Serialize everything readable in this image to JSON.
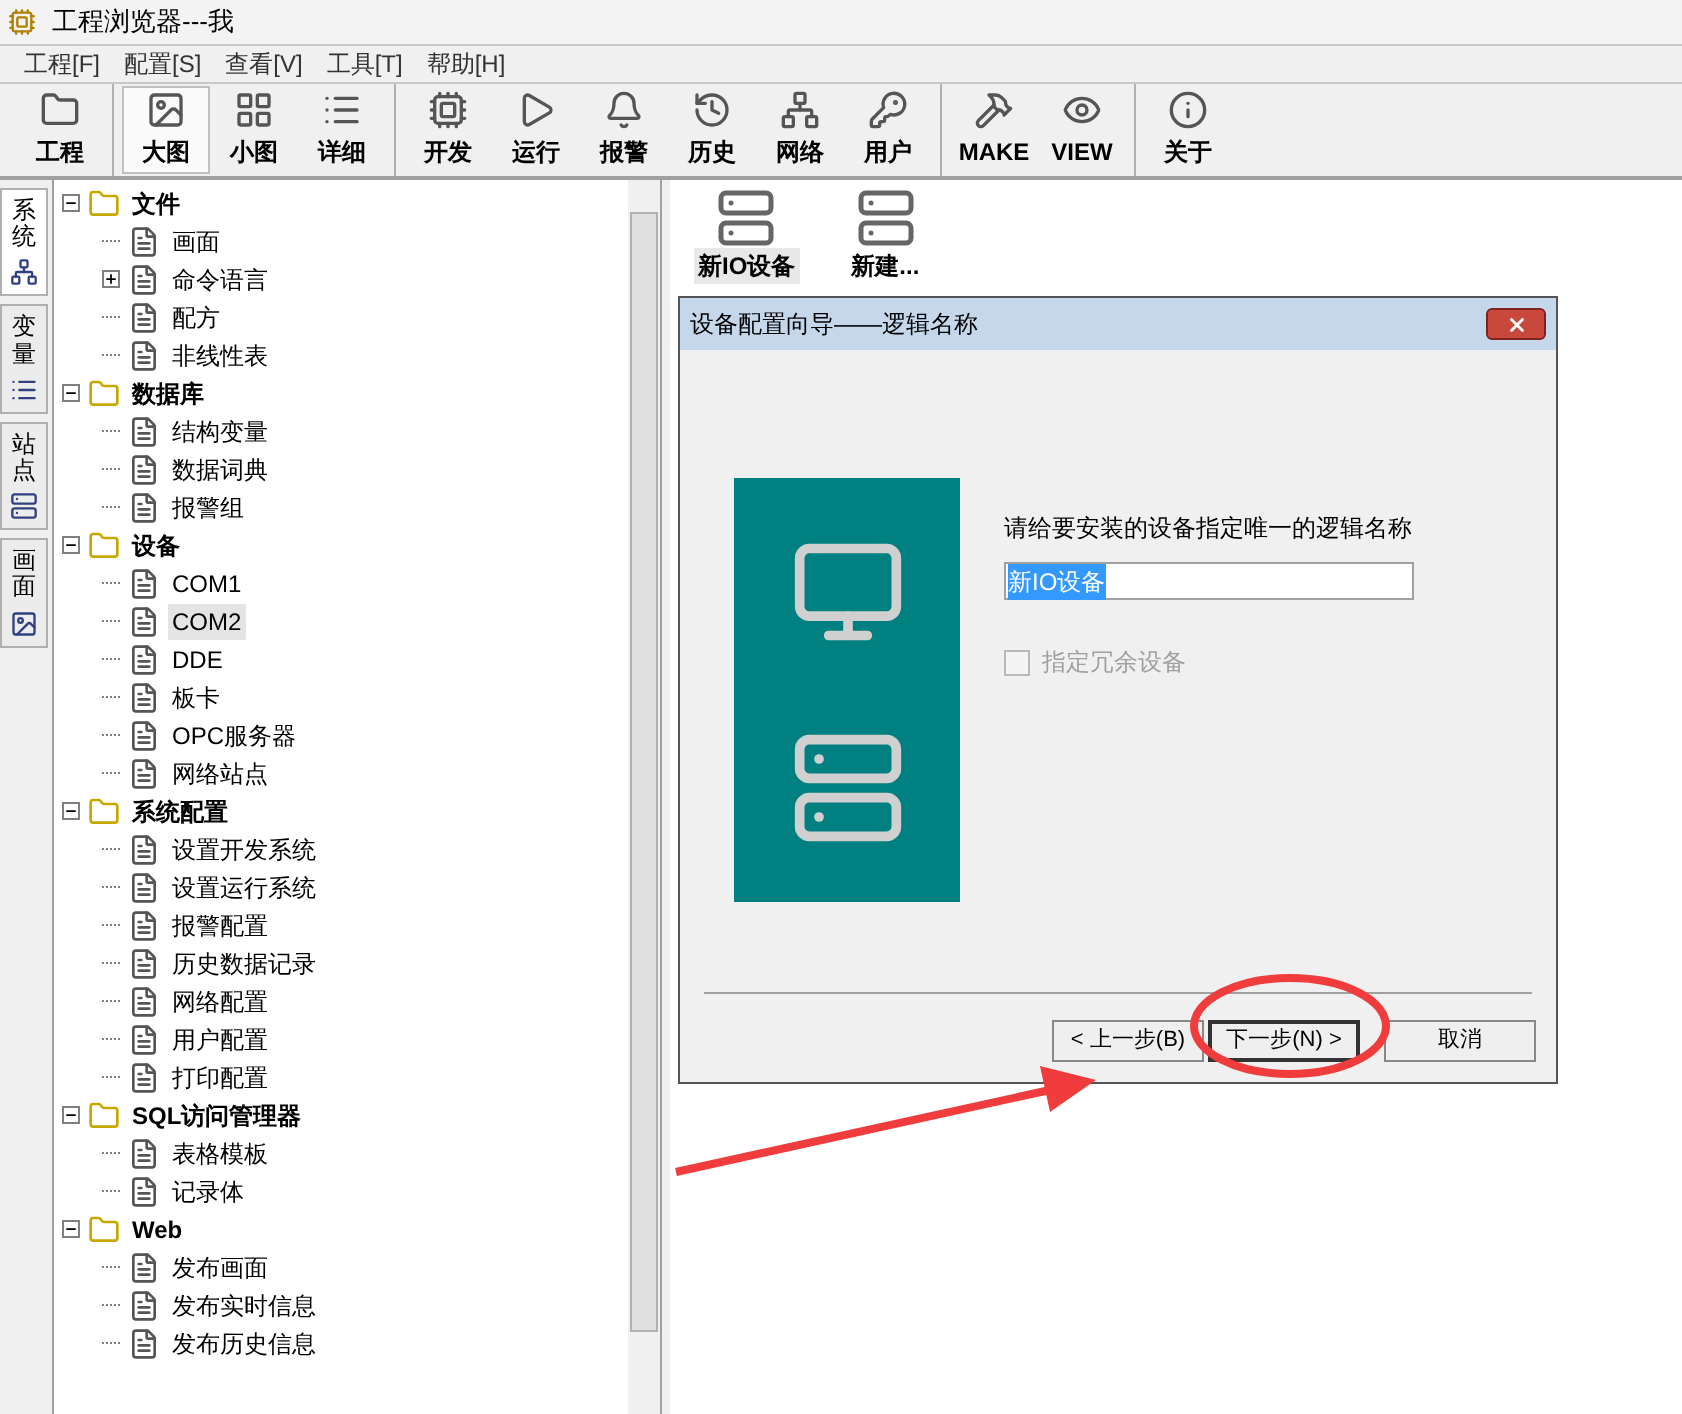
{
  "window": {
    "title": "工程浏览器---我"
  },
  "menu": [
    "工程[F]",
    "配置[S]",
    "查看[V]",
    "工具[T]",
    "帮助[H]"
  ],
  "toolbar": {
    "groups": [
      [
        {
          "label": "工程",
          "selected": false
        }
      ],
      [
        {
          "label": "大图",
          "selected": true
        },
        {
          "label": "小图",
          "selected": false
        },
        {
          "label": "详细",
          "selected": false
        }
      ],
      [
        {
          "label": "开发",
          "selected": false
        },
        {
          "label": "运行",
          "selected": false
        },
        {
          "label": "报警",
          "selected": false
        },
        {
          "label": "历史",
          "selected": false
        },
        {
          "label": "网络",
          "selected": false
        },
        {
          "label": "用户",
          "selected": false
        }
      ],
      [
        {
          "label": "MAKE",
          "selected": false
        },
        {
          "label": "VIEW",
          "selected": false
        }
      ],
      [
        {
          "label": "关于",
          "selected": false
        }
      ]
    ]
  },
  "side_tabs": [
    {
      "label": "系统",
      "selected": true
    },
    {
      "label": "变量",
      "selected": false
    },
    {
      "label": "站点",
      "selected": false
    },
    {
      "label": "画面",
      "selected": false
    }
  ],
  "tree": [
    {
      "label": "文件",
      "expanded": true,
      "children": [
        {
          "label": "画面"
        },
        {
          "label": "命令语言",
          "expanded": false
        },
        {
          "label": "配方"
        },
        {
          "label": "非线性表"
        }
      ]
    },
    {
      "label": "数据库",
      "expanded": true,
      "children": [
        {
          "label": "结构变量"
        },
        {
          "label": "数据词典"
        },
        {
          "label": "报警组"
        }
      ]
    },
    {
      "label": "设备",
      "expanded": true,
      "children": [
        {
          "label": "COM1",
          "selected": false
        },
        {
          "label": "COM2",
          "selected": true
        },
        {
          "label": "DDE",
          "selected": false
        },
        {
          "label": "板卡"
        },
        {
          "label": "OPC服务器"
        },
        {
          "label": "网络站点"
        }
      ]
    },
    {
      "label": "系统配置",
      "expanded": true,
      "children": [
        {
          "label": "设置开发系统"
        },
        {
          "label": "设置运行系统"
        },
        {
          "label": "报警配置"
        },
        {
          "label": "历史数据记录"
        },
        {
          "label": "网络配置"
        },
        {
          "label": "用户配置"
        },
        {
          "label": "打印配置"
        }
      ]
    },
    {
      "label": "SQL访问管理器",
      "expanded": true,
      "children": [
        {
          "label": "表格模板"
        },
        {
          "label": "记录体"
        }
      ]
    },
    {
      "label": "Web",
      "expanded": true,
      "children": [
        {
          "label": "发布画面"
        },
        {
          "label": "发布实时信息"
        },
        {
          "label": "发布历史信息"
        }
      ]
    }
  ],
  "content_items": [
    {
      "label": "新IO设备",
      "selected": true
    },
    {
      "label": "新建...",
      "selected": false
    }
  ],
  "dialog": {
    "title": "设备配置向导——逻辑名称",
    "prompt": "请给要安装的设备指定唯一的逻辑名称",
    "name_field": {
      "value": "新IO设备"
    },
    "redundant": {
      "label": "指定冗余设备",
      "checked": false,
      "disabled": true
    },
    "buttons": [
      {
        "label": "< 上一步(B)",
        "kind": "normal"
      },
      {
        "label": "下一步(N) >",
        "kind": "default"
      },
      {
        "label": "取消",
        "kind": "normal"
      }
    ]
  }
}
